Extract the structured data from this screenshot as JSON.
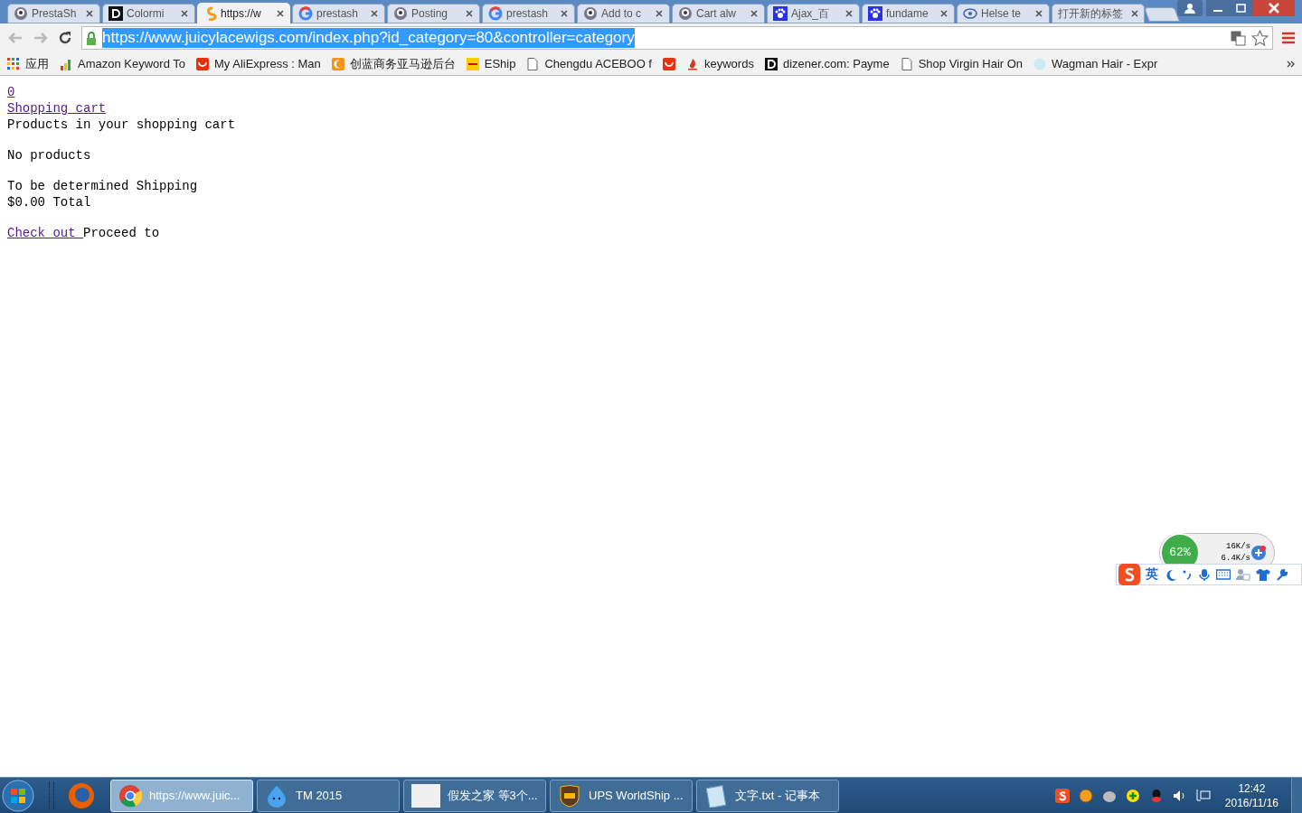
{
  "tabs": [
    {
      "label": "PrestaSh",
      "selected": false
    },
    {
      "label": "Colormi",
      "selected": false
    },
    {
      "label": "https://w",
      "selected": true
    },
    {
      "label": "prestash",
      "selected": false
    },
    {
      "label": "Posting",
      "selected": false
    },
    {
      "label": "prestash",
      "selected": false
    },
    {
      "label": "Add to c",
      "selected": false
    },
    {
      "label": "Cart alw",
      "selected": false
    },
    {
      "label": "Ajax_百",
      "selected": false
    },
    {
      "label": "fundame",
      "selected": false
    },
    {
      "label": "Helse te",
      "selected": false
    },
    {
      "label": "打开新的标签",
      "selected": false
    }
  ],
  "address": {
    "url": "https://www.juicylacewigs.com/index.php?id_category=80&controller=category"
  },
  "bookmarks": [
    {
      "label": "应用"
    },
    {
      "label": "Amazon Keyword To"
    },
    {
      "label": "My AliExpress : Man"
    },
    {
      "label": "创蓝商务亚马逊后台"
    },
    {
      "label": "EShip"
    },
    {
      "label": "Chengdu ACEBOO f"
    },
    {
      "label": "keywords"
    },
    {
      "label": "dizener.com: Payme"
    },
    {
      "label": "Shop Virgin Hair On"
    },
    {
      "label": "Wagman Hair - Expr"
    }
  ],
  "page": {
    "cart_count": "0",
    "cart_link": "Shopping cart",
    "heading": "Products in your shopping cart",
    "empty": "No products",
    "shipping": "To be determined Shipping",
    "total": "$0.00 Total",
    "checkout_link": "Check out ",
    "checkout_after": "Proceed to"
  },
  "net_widget": {
    "percent": "62%",
    "upload": "16K/s",
    "download": "6.4K/s"
  },
  "ime_bar": {
    "language": "英"
  },
  "taskbar": [
    {
      "label": "https://www.juic...",
      "selected": true
    },
    {
      "label": "TM 2015",
      "selected": false
    },
    {
      "label": "假发之家  等3个...",
      "selected": false
    },
    {
      "label": "UPS WorldShip ...",
      "selected": false
    },
    {
      "label": "文字.txt - 记事本",
      "selected": false
    }
  ],
  "clock": {
    "time": "12:42",
    "date": "2016/11/16"
  }
}
